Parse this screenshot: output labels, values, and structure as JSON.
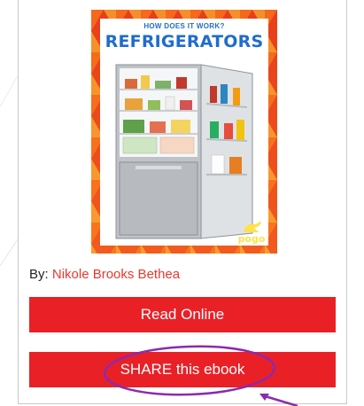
{
  "book": {
    "series_label": "HOW DOES IT WORK?",
    "title": "REFRIGERATORS",
    "publisher_logo": "pogo"
  },
  "byline": {
    "prefix": "By:",
    "author": "Nikole Brooks Bethea"
  },
  "actions": {
    "read_online": "Read Online",
    "share": "SHARE this ebook"
  },
  "colors": {
    "button": "#ea2027",
    "author_link": "#e63a2e",
    "title_blue": "#1f6dcc",
    "annotation": "#8a2bb0"
  }
}
